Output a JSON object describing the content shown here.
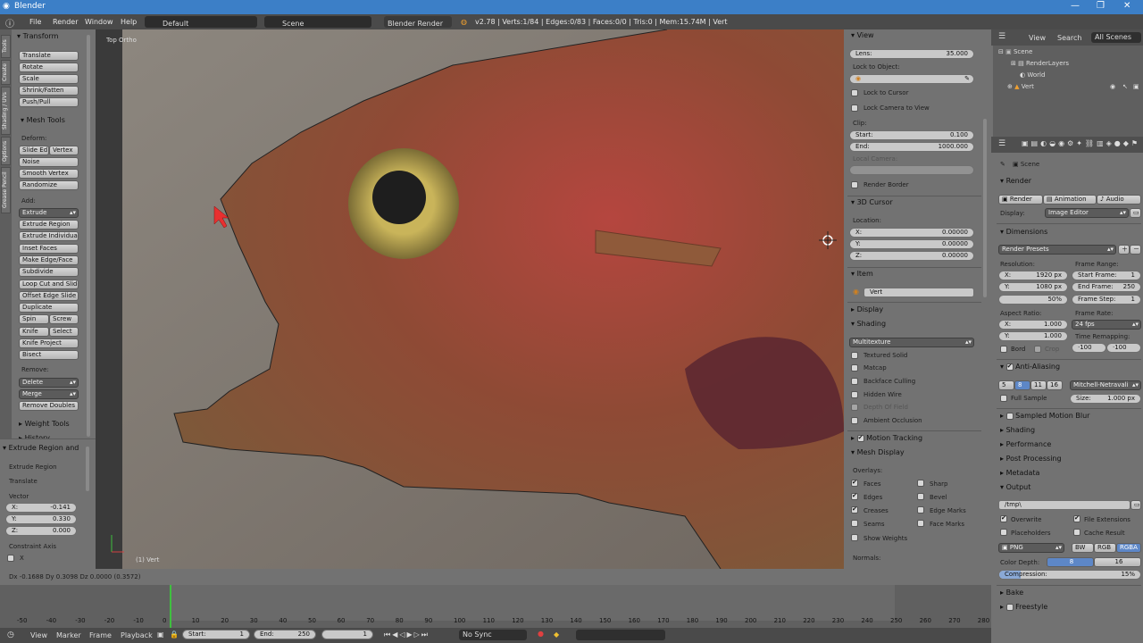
{
  "window": {
    "title": "Blender"
  },
  "info_bar": {
    "menus": [
      "File",
      "Render",
      "Window",
      "Help"
    ],
    "layout": "Default",
    "scene": "Scene",
    "engine": "Blender Render",
    "stats": "v2.78 | Verts:1/84 | Edges:0/83 | Faces:0/0 | Tris:0 | Mem:15.74M | Vert"
  },
  "toolshelf": {
    "tabs": [
      "Tools",
      "Create",
      "Shading / UVs",
      "Options",
      "Grease Pencil"
    ],
    "transform_header": "Transform",
    "transform": [
      "Translate",
      "Rotate",
      "Scale",
      "Shrink/Fatten",
      "Push/Pull"
    ],
    "mesh_tools_header": "Mesh Tools",
    "deform_label": "Deform:",
    "slide_edge": "Slide Ed",
    "vertex": "Vertex",
    "noise": "Noise",
    "smooth_vertex": "Smooth Vertex",
    "randomize": "Randomize",
    "add_label": "Add:",
    "extrude": "Extrude",
    "add_tools": [
      "Extrude Region",
      "Extrude Individual",
      "Inset Faces",
      "Make Edge/Face",
      "Subdivide",
      "Loop Cut and Slide",
      "Offset Edge Slide",
      "Duplicate"
    ],
    "spin": "Spin",
    "screw": "Screw",
    "knife": "Knife",
    "select": "Select",
    "knife_project": "Knife Project",
    "bisect": "Bisect",
    "remove_label": "Remove:",
    "delete": "Delete",
    "merge": "Merge",
    "remove_doubles": "Remove Doubles",
    "weight_tools": "Weight Tools",
    "history": "History"
  },
  "operator_panel": {
    "header": "Extrude Region and",
    "op1": "Extrude Region",
    "op2": "Translate",
    "vector_label": "Vector",
    "x_label": "X:",
    "x_value": "-0.141",
    "y_label": "Y:",
    "y_value": "0.330",
    "z_label": "Z:",
    "z_value": "0.000",
    "constraint_label": "Constraint Axis",
    "constraint_x": "X"
  },
  "viewport": {
    "view_label": "Top Ortho",
    "object_label": "(1) Vert"
  },
  "npanel": {
    "view_header": "View",
    "lens_label": "Lens:",
    "lens_value": "35.000",
    "lock_object_label": "Lock to Object:",
    "lock_cursor": "Lock to Cursor",
    "lock_camera": "Lock Camera to View",
    "clip_label": "Clip:",
    "clip_start_label": "Start:",
    "clip_start": "0.100",
    "clip_end_label": "End:",
    "clip_end": "1000.000",
    "local_camera": "Local Camera:",
    "render_border": "Render Border",
    "cursor_header": "3D Cursor",
    "location_label": "Location:",
    "cx_label": "X:",
    "cx": "0.00000",
    "cy_label": "Y:",
    "cy": "0.00000",
    "cz_label": "Z:",
    "cz": "0.00000",
    "item_header": "Item",
    "item_name": "Vert",
    "display_header": "Display",
    "shading_header": "Shading",
    "shading_mode": "Multitexture",
    "textured_solid": "Textured Solid",
    "matcap": "Matcap",
    "backface": "Backface Culling",
    "hidden_wire": "Hidden Wire",
    "dof": "Depth Of Field",
    "ao": "Ambient Occlusion",
    "motion_tracking": "Motion Tracking",
    "mesh_display_header": "Mesh Display",
    "overlays_label": "Overlays:",
    "faces": "Faces",
    "sharp": "Sharp",
    "edges": "Edges",
    "bevel": "Bevel",
    "creases": "Creases",
    "edge_marks": "Edge Marks",
    "seams": "Seams",
    "face_marks": "Face Marks",
    "show_weights": "Show Weights",
    "normals_label": "Normals:"
  },
  "outliner": {
    "menus": [
      "View",
      "Search"
    ],
    "filter": "All Scenes",
    "items": [
      "Scene",
      "RenderLayers",
      "World",
      "Vert"
    ]
  },
  "properties": {
    "scene_label": "Scene",
    "render_header": "Render",
    "render_btn": "Render",
    "animation_btn": "Animation",
    "audio_btn": "Audio",
    "display_label": "Display:",
    "display_value": "Image Editor",
    "dimensions_header": "Dimensions",
    "render_presets": "Render Presets",
    "resolution_label": "Resolution:",
    "res_x_label": "X:",
    "res_x": "1920 px",
    "res_y_label": "Y:",
    "res_y": "1080 px",
    "res_pct": "50%",
    "frame_range_label": "Frame Range:",
    "start_frame_label": "Start Frame:",
    "start_frame": "1",
    "end_frame_label": "End Frame:",
    "end_frame": "250",
    "frame_step_label": "Frame Step:",
    "frame_step": "1",
    "aspect_label": "Aspect Ratio:",
    "asp_x_label": "X:",
    "asp_x": "1.000",
    "asp_y_label": "Y:",
    "asp_y": "1.000",
    "frame_rate_label": "Frame Rate:",
    "frame_rate": "24 fps",
    "time_remap_label": "Time Remapping:",
    "remap_old": "·100",
    "remap_new": "·100",
    "bord": "Bord",
    "crop": "Crop",
    "aa_header": "Anti-Aliasing",
    "aa_samples": [
      "5",
      "8",
      "11",
      "16"
    ],
    "aa_filter": "Mitchell-Netravali",
    "full_sample": "Full Sample",
    "size_label": "Size:",
    "size_value": "1.000 px",
    "motion_blur": "Sampled Motion Blur",
    "shading": "Shading",
    "performance": "Performance",
    "post_processing": "Post Processing",
    "metadata": "Metadata",
    "output_header": "Output",
    "output_path": "/tmp\\",
    "overwrite": "Overwrite",
    "file_ext": "File Extensions",
    "placeholders": "Placeholders",
    "cache_result": "Cache Result",
    "format": "PNG",
    "bw": "BW",
    "rgb": "RGB",
    "rgba": "RGBA",
    "color_depth_label": "Color Depth:",
    "depth_8": "8",
    "depth_16": "16",
    "compression_label": "Compression:",
    "compression": "15%",
    "bake": "Bake",
    "freestyle": "Freestyle"
  },
  "status": {
    "delta": "Dx -0.1688  Dy 0.3098  Dz 0.0000 (0.3572)"
  },
  "timeline": {
    "ticks": [
      "-50",
      "-40",
      "-30",
      "-20",
      "-10",
      "0",
      "10",
      "20",
      "30",
      "40",
      "50",
      "60",
      "70",
      "80",
      "90",
      "100",
      "110",
      "120",
      "130",
      "140",
      "150",
      "160",
      "170",
      "180",
      "190",
      "200",
      "210",
      "220",
      "230",
      "240",
      "250",
      "260",
      "270",
      "280"
    ],
    "menus": [
      "View",
      "Marker",
      "Frame",
      "Playback"
    ],
    "start_label": "Start:",
    "start": "1",
    "end_label": "End:",
    "end": "250",
    "current": "1",
    "sync": "No Sync"
  },
  "colors": {
    "accent_blue": "#5d87c7",
    "titlebar": "#3c7fc7",
    "timeline_cursor": "#3fc03f"
  }
}
